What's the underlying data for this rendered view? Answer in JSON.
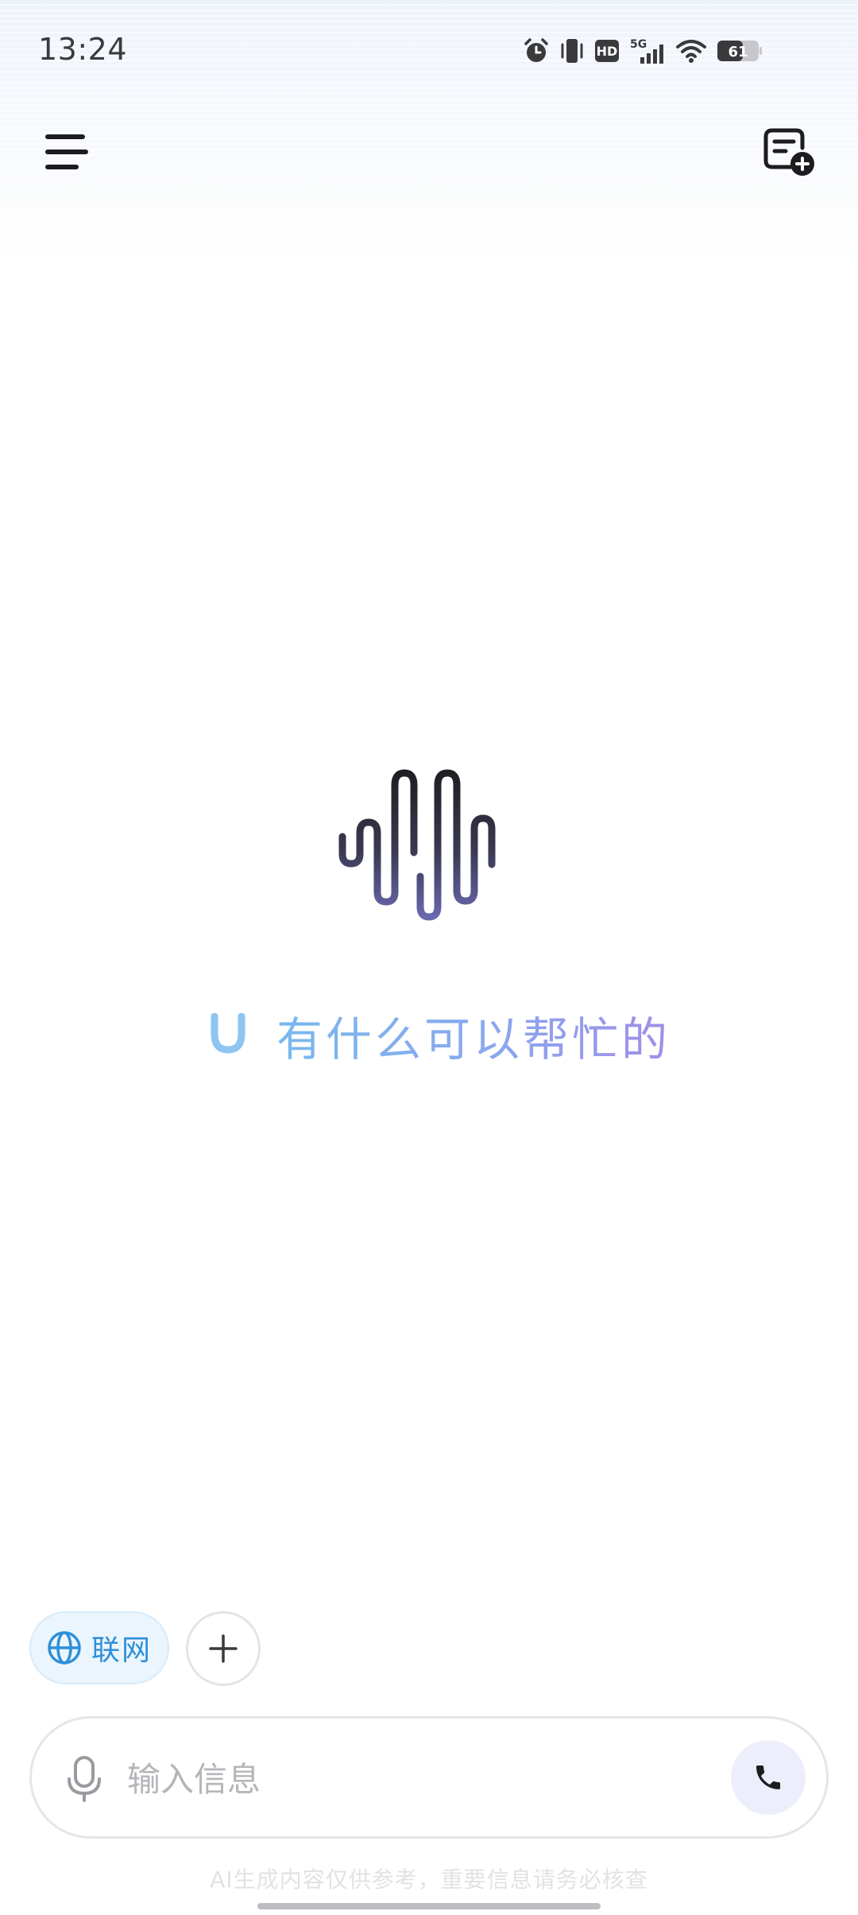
{
  "status_bar": {
    "time": "13:24",
    "network_label": "5G",
    "hd_label": "HD",
    "battery_level": "61",
    "icons": [
      "alarm-icon",
      "vibrate-icon",
      "hd-icon",
      "cellular-5g-icon",
      "wifi-icon",
      "battery-icon"
    ]
  },
  "header": {
    "menu_icon": "menu-icon",
    "new_chat_icon": "new-chat-icon"
  },
  "main": {
    "logo_icon": "voice-wave-logo",
    "greeting_icon": "magnet-icon",
    "greeting": "有什么可以帮忙的"
  },
  "chips": {
    "web_search_label": "联网",
    "web_search_icon": "globe-icon",
    "add_icon": "plus-icon"
  },
  "composer": {
    "placeholder": "输入信息",
    "mic_icon": "microphone-icon",
    "call_icon": "phone-icon"
  },
  "footer": {
    "disclaimer": "AI生成内容仅供参考，重要信息请务必核查"
  },
  "colors": {
    "accent_blue": "#2f8fd8",
    "greeting_gradient_start": "#79b8ee",
    "greeting_gradient_end": "#a18ee8",
    "chip_background": "#eaf5fd",
    "call_button_background": "#eceefb"
  }
}
